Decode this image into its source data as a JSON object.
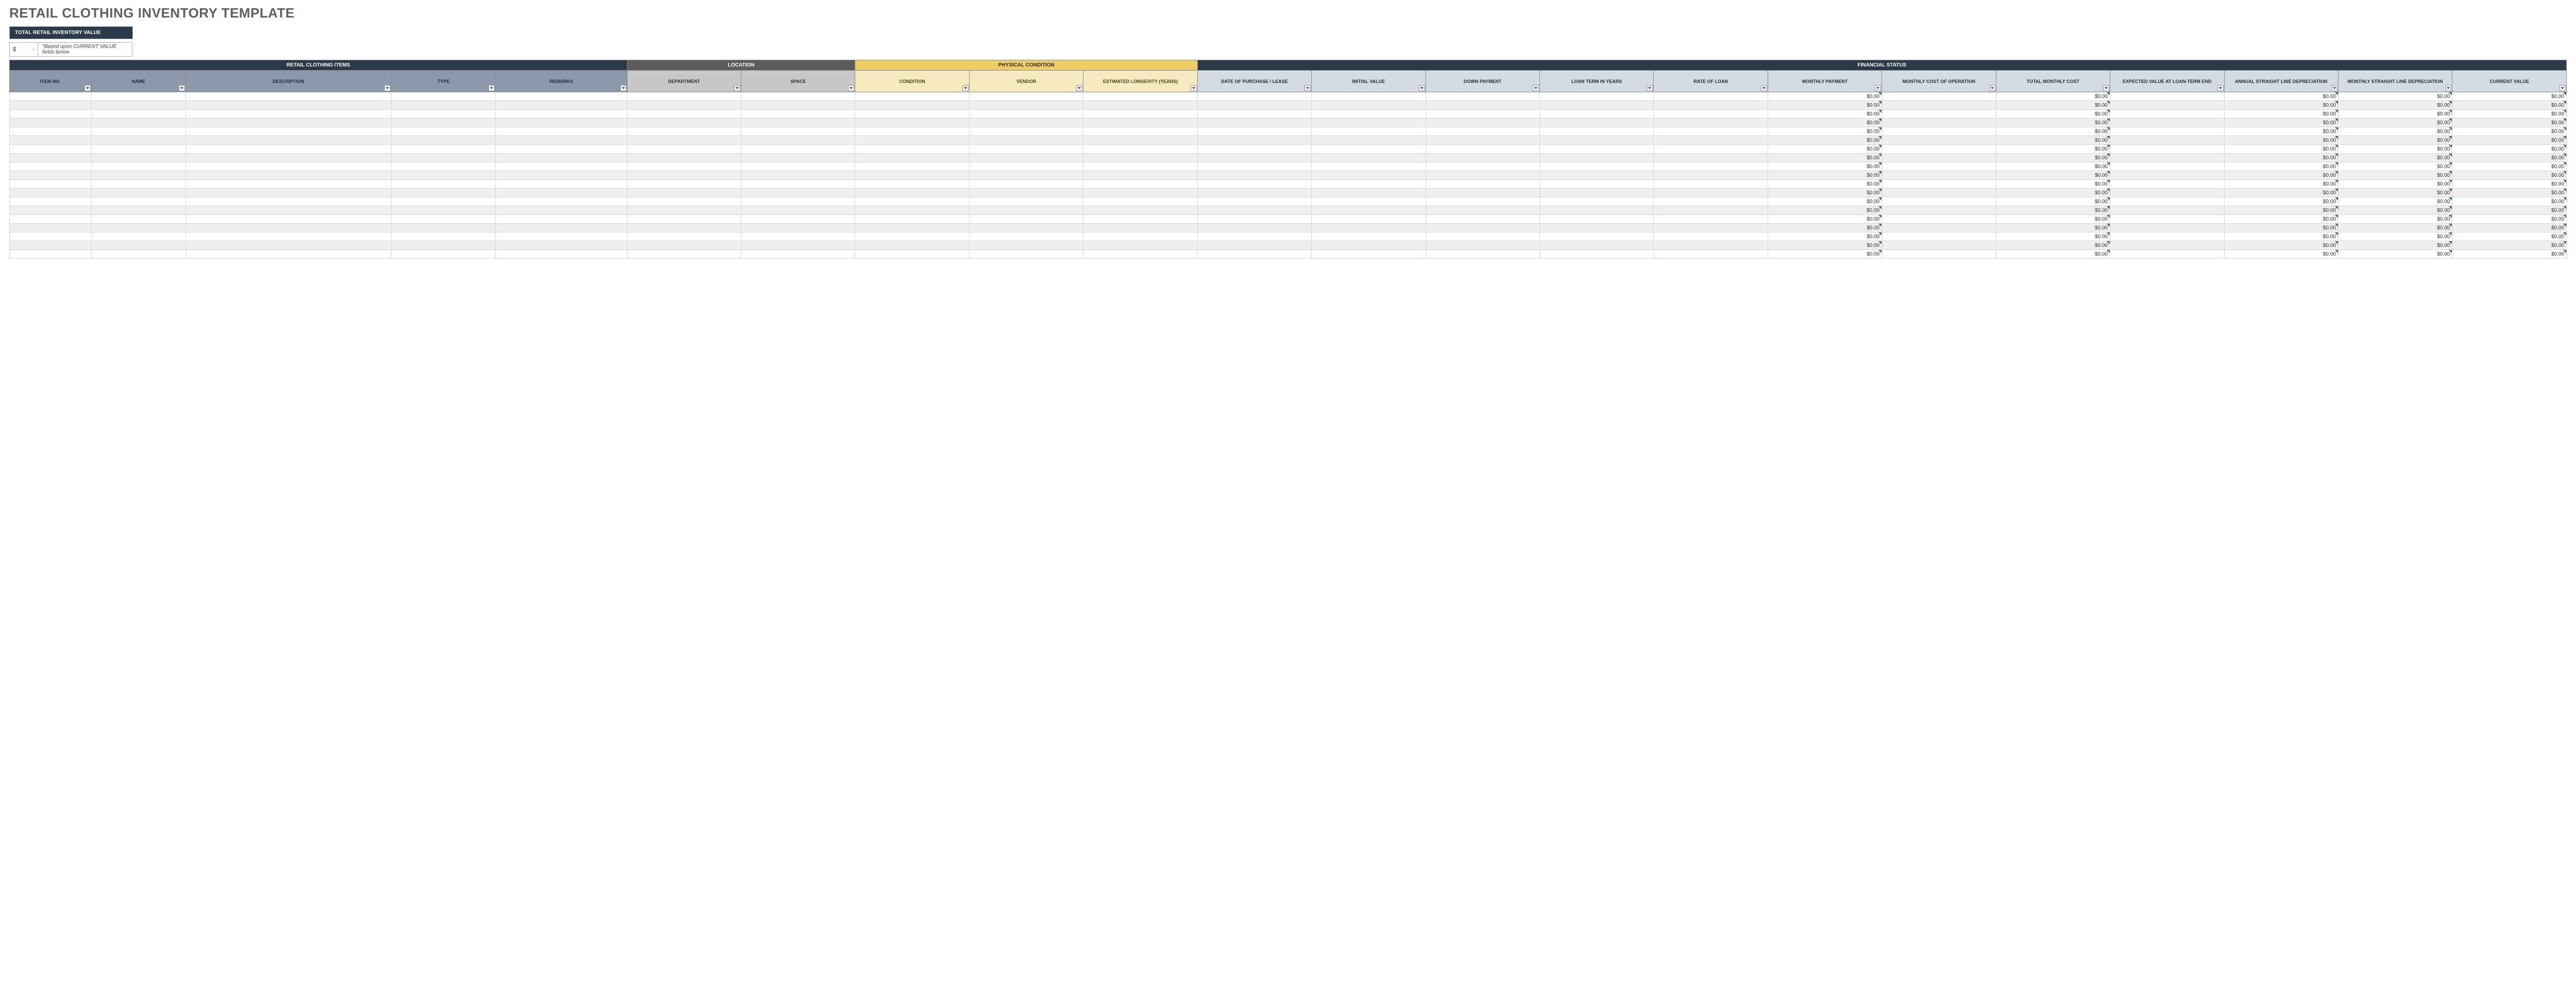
{
  "title": "RETAIL CLOTHING INVENTORY TEMPLATE",
  "summary": {
    "label": "TOTAL RETAIL INVENTORY VALUE",
    "currency": "$",
    "value": "-",
    "note": "*Based upon CURRENT VALUE fields below"
  },
  "groups": {
    "items": "RETAIL CLOTHING ITEMS",
    "location": "LOCATION",
    "physical": "PHYSICAL CONDITION",
    "financial": "FINANCIAL STATUS"
  },
  "columns": [
    {
      "key": "item_no",
      "label": "ITEM NO.",
      "group": "items"
    },
    {
      "key": "name",
      "label": "NAME",
      "group": "items"
    },
    {
      "key": "description",
      "label": "DESCRIPTION",
      "group": "items"
    },
    {
      "key": "type",
      "label": "TYPE",
      "group": "items"
    },
    {
      "key": "remarks",
      "label": "REMARKS",
      "group": "items"
    },
    {
      "key": "department",
      "label": "DEPARTMENT",
      "group": "location"
    },
    {
      "key": "space",
      "label": "SPACE",
      "group": "location"
    },
    {
      "key": "condition",
      "label": "CONDITION",
      "group": "physical"
    },
    {
      "key": "vendor",
      "label": "VENDOR",
      "group": "physical"
    },
    {
      "key": "est_longevity",
      "label": "ESTIMATED LONGEVITY (YEARS)",
      "group": "physical"
    },
    {
      "key": "date_purchase",
      "label": "DATE OF PURCHASE / LEASE",
      "group": "financial"
    },
    {
      "key": "initial_value",
      "label": "INITIAL VALUE",
      "group": "financial"
    },
    {
      "key": "down_payment",
      "label": "DOWN PAYMENT",
      "group": "financial"
    },
    {
      "key": "loan_term",
      "label": "LOAN TERM IN YEARS",
      "group": "financial"
    },
    {
      "key": "rate_of_loan",
      "label": "RATE OF LOAN",
      "group": "financial"
    },
    {
      "key": "monthly_payment",
      "label": "MONTHLY PAYMENT",
      "group": "financial",
      "calc": true
    },
    {
      "key": "monthly_cost_op",
      "label": "MONTHLY COST OF OPERATION",
      "group": "financial"
    },
    {
      "key": "total_monthly_cost",
      "label": "TOTAL MONTHLY COST",
      "group": "financial",
      "calc": true
    },
    {
      "key": "expected_value_end",
      "label": "EXPECTED VALUE AT LOAN-TERM END",
      "group": "financial"
    },
    {
      "key": "annual_sl_dep",
      "label": "ANNUAL STRAIGHT LINE DEPRECIATION",
      "group": "financial",
      "calc": true
    },
    {
      "key": "monthly_sl_dep",
      "label": "MONTHLY STRAIGHT LINE DEPRECIATION",
      "group": "financial",
      "calc": true
    },
    {
      "key": "current_value",
      "label": "CURRENT VALUE",
      "group": "financial",
      "calc": true
    }
  ],
  "calc_cell_display": "$0.00",
  "row_count": 19,
  "colors": {
    "dark_header": "#2b3a4a",
    "grey_header": "#5d5d5d",
    "yellow_header": "#f0cd62",
    "items_sub": "#8b99aa",
    "loc_sub": "#c8c8c8",
    "phys_sub": "#f6eac0",
    "fin_sub": "#d5dbe3"
  }
}
